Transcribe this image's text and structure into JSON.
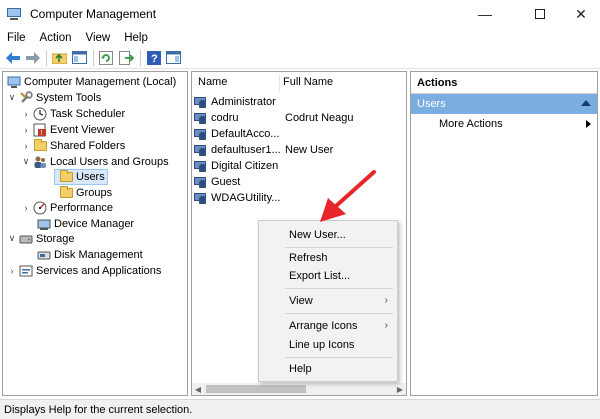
{
  "window": {
    "title": "Computer Management"
  },
  "menu": [
    "File",
    "Action",
    "View",
    "Help"
  ],
  "tree": {
    "root": "Computer Management (Local)",
    "system_tools": "System Tools",
    "task_scheduler": "Task Scheduler",
    "event_viewer": "Event Viewer",
    "shared_folders": "Shared Folders",
    "local_users_groups": "Local Users and Groups",
    "users": "Users",
    "groups": "Groups",
    "performance": "Performance",
    "device_manager": "Device Manager",
    "storage": "Storage",
    "disk_management": "Disk Management",
    "services_apps": "Services and Applications"
  },
  "list": {
    "col_name": "Name",
    "col_fullname": "Full Name",
    "rows": [
      {
        "name": "Administrator",
        "full": ""
      },
      {
        "name": "codru",
        "full": "Codrut Neagu"
      },
      {
        "name": "DefaultAcco...",
        "full": ""
      },
      {
        "name": "defaultuser1...",
        "full": "New User"
      },
      {
        "name": "Digital Citizen",
        "full": ""
      },
      {
        "name": "Guest",
        "full": ""
      },
      {
        "name": "WDAGUtility...",
        "full": ""
      }
    ]
  },
  "actions": {
    "header": "Actions",
    "section": "Users",
    "more": "More Actions"
  },
  "context_menu": {
    "new_user": "New User...",
    "refresh": "Refresh",
    "export": "Export List...",
    "view": "View",
    "arrange": "Arrange Icons",
    "lineup": "Line up Icons",
    "help": "Help"
  },
  "status": "Displays Help for the current selection.",
  "colors": {
    "accent": "#7aaee0",
    "arrow": "#e8262a"
  }
}
